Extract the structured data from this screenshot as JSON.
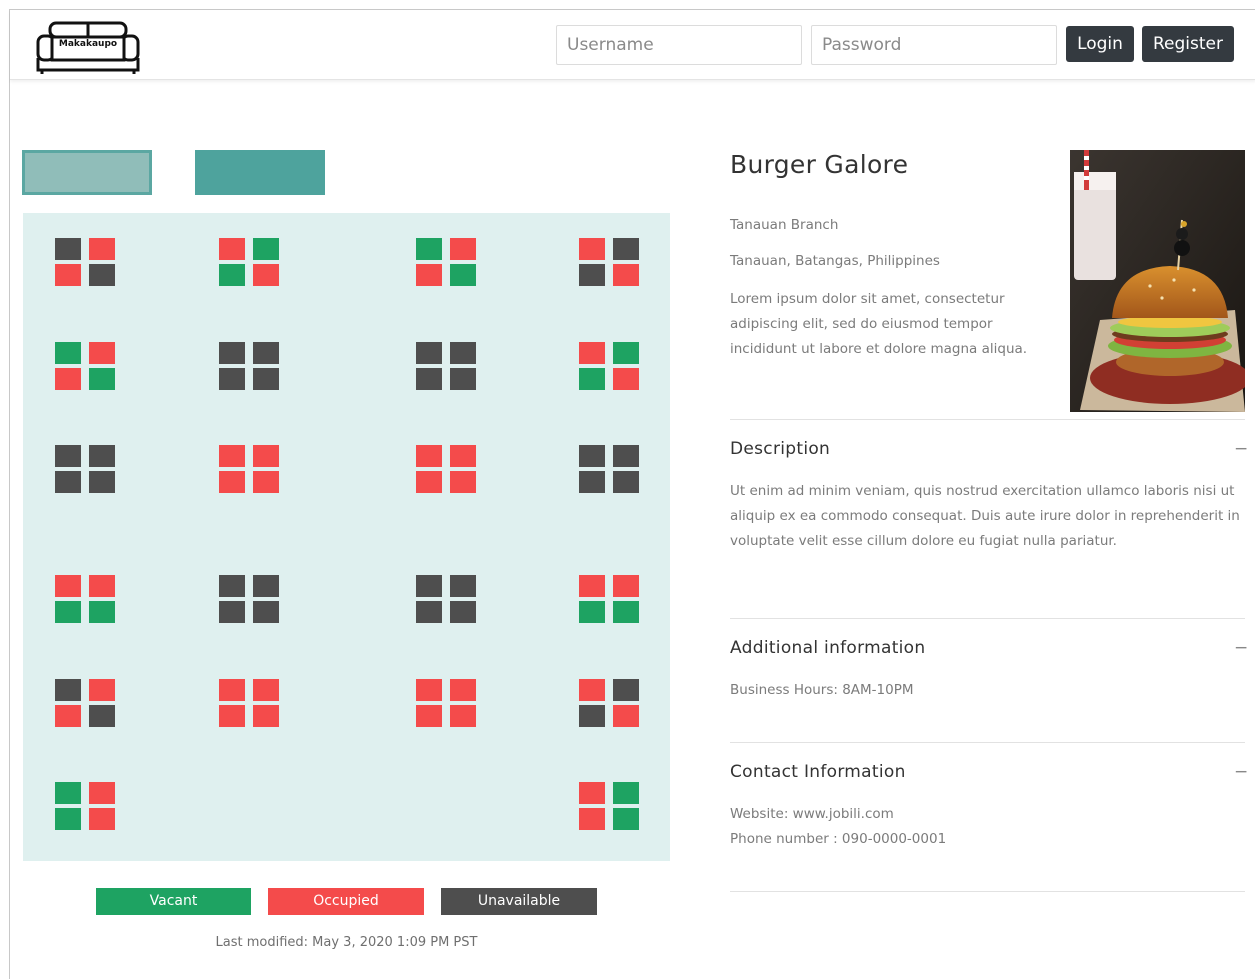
{
  "header": {
    "logo_text": "Makakaupo",
    "username_placeholder": "Username",
    "password_placeholder": "Password",
    "login_label": "Login",
    "register_label": "Register"
  },
  "tabs": [
    {
      "label": ""
    },
    {
      "label": ""
    }
  ],
  "status_colors": {
    "vacant": "#1ea362",
    "occupied": "#f44b4b",
    "unavailable": "#4e4e4e"
  },
  "floor_plan": {
    "rows": [
      [
        [
          "d",
          "r",
          "r",
          "d"
        ],
        [
          "r",
          "g",
          "g",
          "r"
        ],
        [
          "g",
          "r",
          "r",
          "g"
        ],
        [
          "r",
          "d",
          "d",
          "r"
        ]
      ],
      [
        [
          "g",
          "r",
          "r",
          "g"
        ],
        [
          "d",
          "d",
          "d",
          "d"
        ],
        [
          "d",
          "d",
          "d",
          "d"
        ],
        [
          "r",
          "g",
          "g",
          "r"
        ]
      ],
      [
        [
          "d",
          "d",
          "d",
          "d"
        ],
        [
          "r",
          "r",
          "r",
          "r"
        ],
        [
          "r",
          "r",
          "r",
          "r"
        ],
        [
          "d",
          "d",
          "d",
          "d"
        ]
      ],
      [
        [
          "r",
          "r",
          "g",
          "g"
        ],
        [
          "d",
          "d",
          "d",
          "d"
        ],
        [
          "d",
          "d",
          "d",
          "d"
        ],
        [
          "r",
          "r",
          "g",
          "g"
        ]
      ],
      [
        [
          "d",
          "r",
          "r",
          "d"
        ],
        [
          "r",
          "r",
          "r",
          "r"
        ],
        [
          "r",
          "r",
          "r",
          "r"
        ],
        [
          "r",
          "d",
          "d",
          "r"
        ]
      ],
      [
        [
          "g",
          "r",
          "g",
          "r"
        ],
        null,
        null,
        [
          "r",
          "g",
          "r",
          "g"
        ]
      ]
    ]
  },
  "legend": {
    "vacant": "Vacant",
    "occupied": "Occupied",
    "unavailable": "Unavailable"
  },
  "last_modified": "Last modified: May 3, 2020 1:09 PM PST",
  "restaurant": {
    "name": "Burger Galore",
    "branch": "Tanauan Branch",
    "address": "Tanauan, Batangas, Philippines",
    "summary": "Lorem ipsum dolor sit amet, consectetur adipiscing elit, sed do eiusmod tempor incididunt ut labore et dolore magna aliqua."
  },
  "sections": {
    "description": {
      "title": "Description",
      "toggle": "−",
      "body": "Ut enim ad minim veniam, quis nostrud exercitation ullamco laboris nisi ut aliquip ex ea commodo consequat. Duis aute irure dolor in reprehenderit in voluptate velit esse cillum dolore eu fugiat nulla pariatur."
    },
    "additional": {
      "title": "Additional information",
      "toggle": "−",
      "body": "Business Hours: 8AM-10PM"
    },
    "contact": {
      "title": "Contact Information",
      "toggle": "−",
      "website": "Website: www.jobili.com",
      "phone": "Phone number : 090-0000-0001"
    }
  }
}
